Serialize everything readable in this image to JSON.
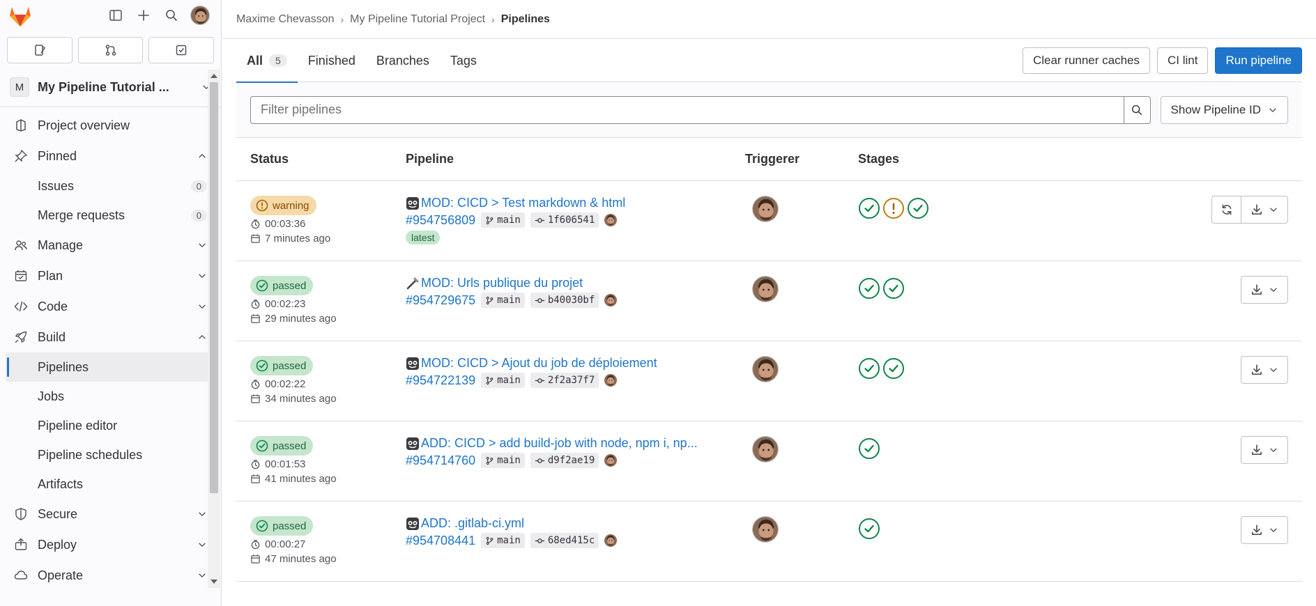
{
  "sidebar": {
    "project": {
      "initial": "M",
      "name": "My Pipeline Tutorial ..."
    },
    "items": {
      "overview": "Project overview",
      "pinned": "Pinned",
      "issues": "Issues",
      "issues_count": "0",
      "mrs": "Merge requests",
      "mrs_count": "0",
      "manage": "Manage",
      "plan": "Plan",
      "code": "Code",
      "build": "Build",
      "pipelines": "Pipelines",
      "jobs": "Jobs",
      "editor": "Pipeline editor",
      "schedules": "Pipeline schedules",
      "artifacts": "Artifacts",
      "secure": "Secure",
      "deploy": "Deploy",
      "operate": "Operate"
    }
  },
  "breadcrumb": {
    "user": "Maxime Chevasson",
    "project": "My Pipeline Tutorial Project",
    "current": "Pipelines"
  },
  "tabs": {
    "all": "All",
    "all_count": "5",
    "finished": "Finished",
    "branches": "Branches",
    "tags": "Tags"
  },
  "actions": {
    "clear_caches": "Clear runner caches",
    "ci_lint": "CI lint",
    "run_pipeline": "Run pipeline"
  },
  "filter": {
    "placeholder": "Filter pipelines",
    "show_id": "Show Pipeline ID"
  },
  "table": {
    "headers": {
      "status": "Status",
      "pipeline": "Pipeline",
      "triggerer": "Triggerer",
      "stages": "Stages"
    },
    "rows": [
      {
        "status": "warning",
        "duration": "00:03:36",
        "when": "7 minutes ago",
        "title": "MOD: CICD > Test markdown & html",
        "id": "#954756809",
        "branch": "main",
        "sha": "1f606541",
        "tag": "latest"
      },
      {
        "status": "passed",
        "duration": "00:02:23",
        "when": "29 minutes ago",
        "title": "MOD: Urls publique du projet",
        "id": "#954729675",
        "branch": "main",
        "sha": "b40030bf"
      },
      {
        "status": "passed",
        "duration": "00:02:22",
        "when": "34 minutes ago",
        "title": "MOD: CICD > Ajout du job de déploiement",
        "id": "#954722139",
        "branch": "main",
        "sha": "2f2a37f7"
      },
      {
        "status": "passed",
        "duration": "00:01:53",
        "when": "41 minutes ago",
        "title": "ADD: CICD > add build-job with node, npm i, np...",
        "id": "#954714760",
        "branch": "main",
        "sha": "d9f2ae19"
      },
      {
        "status": "passed",
        "duration": "00:00:27",
        "when": "47 minutes ago",
        "title": "ADD: .gitlab-ci.yml",
        "id": "#954708441",
        "branch": "main",
        "sha": "68ed415c"
      }
    ]
  },
  "colors": {
    "brand": "#fc6d26",
    "primary": "#1f75cb",
    "success": "#108548",
    "warning": "#c17d10"
  }
}
